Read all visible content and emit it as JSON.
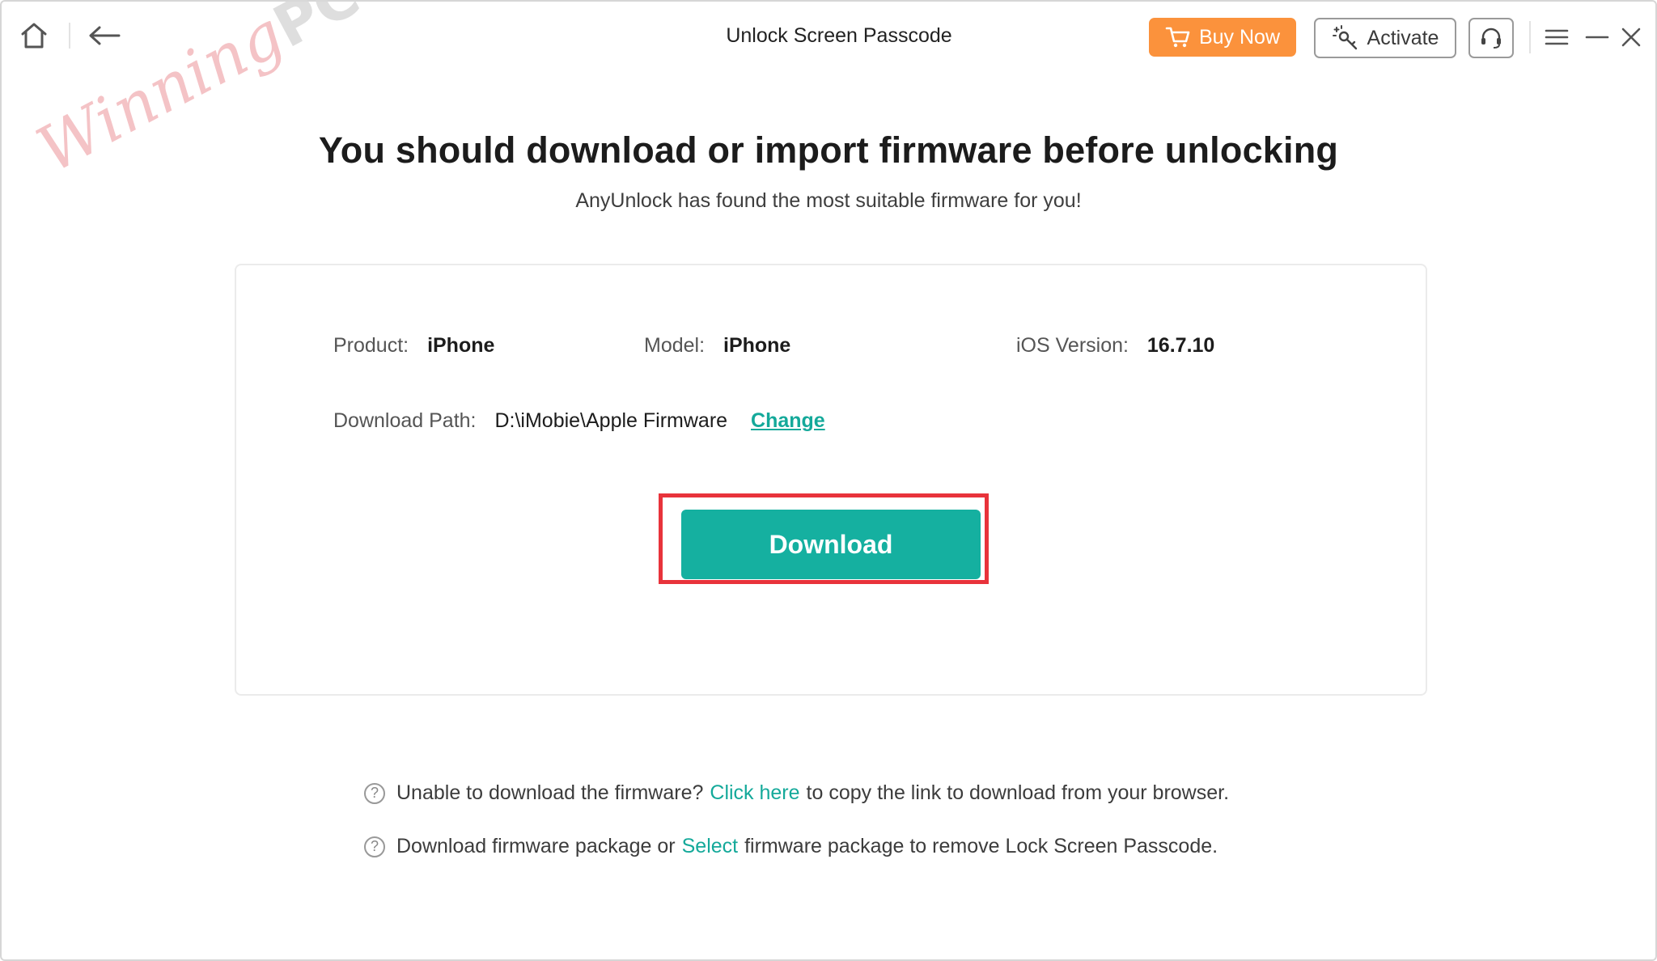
{
  "window": {
    "title": "Unlock Screen Passcode"
  },
  "toolbar": {
    "buy_now_label": "Buy Now",
    "activate_label": "Activate"
  },
  "watermark": {
    "script": "Winning",
    "brand": "PC"
  },
  "main": {
    "heading": "You should download or import firmware before unlocking",
    "subheading": "AnyUnlock has found the most suitable firmware for you!"
  },
  "device": {
    "product_label": "Product:",
    "product_value": "iPhone",
    "model_label": "Model:",
    "model_value": "iPhone",
    "ios_label": "iOS Version:",
    "ios_value": "16.7.10"
  },
  "download_path": {
    "label": "Download Path:",
    "value": "D:\\iMobie\\Apple Firmware",
    "change_label": "Change"
  },
  "actions": {
    "download_label": "Download"
  },
  "help": {
    "line1_prefix": "Unable to download the firmware?",
    "line1_link": "Click here",
    "line1_suffix": "to copy the link to download from your browser.",
    "line2_prefix": "Download firmware package or",
    "line2_link": "Select",
    "line2_suffix": "firmware package to remove Lock Screen Passcode.",
    "icon_glyph": "?"
  },
  "colors": {
    "accent_teal": "#15b0a0",
    "buy_orange": "#fb923c",
    "highlight_red": "#e8333b"
  },
  "icons": {
    "home": "home-icon",
    "back": "back-arrow-icon",
    "cart": "cart-icon",
    "activate": "key-sparkle-icon",
    "support": "headset-icon",
    "menu": "menu-icon",
    "minimize": "minimize-icon",
    "close": "close-icon",
    "help": "question-circle-icon"
  }
}
